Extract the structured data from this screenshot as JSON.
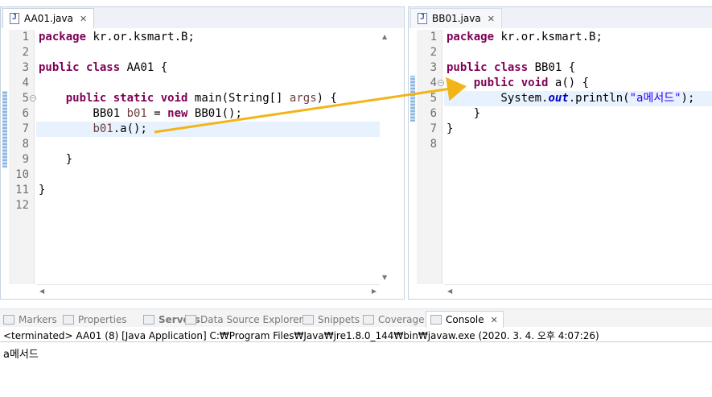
{
  "left_editor": {
    "tab_label": "AA01.java",
    "line_numbers": [
      "1",
      "2",
      "3",
      "4",
      "5",
      "6",
      "7",
      "8",
      "9",
      "10",
      "11",
      "12"
    ],
    "lines": [
      [
        {
          "t": "package ",
          "c": "kw"
        },
        {
          "t": "kr.or.ksmart.B;"
        }
      ],
      [],
      [
        {
          "t": "public ",
          "c": "kw"
        },
        {
          "t": "class ",
          "c": "kw"
        },
        {
          "t": "AA01 {"
        }
      ],
      [],
      [
        {
          "t": "    "
        },
        {
          "t": "public ",
          "c": "kw"
        },
        {
          "t": "static ",
          "c": "kw"
        },
        {
          "t": "void ",
          "c": "kw"
        },
        {
          "t": "main(String[] "
        },
        {
          "t": "args",
          "c": "param"
        },
        {
          "t": ") {"
        }
      ],
      [
        {
          "t": "        BB01 "
        },
        {
          "t": "b01",
          "c": "var"
        },
        {
          "t": " = "
        },
        {
          "t": "new ",
          "c": "kw"
        },
        {
          "t": "BB01();"
        }
      ],
      [
        {
          "t": "        "
        },
        {
          "t": "b01",
          "c": "var"
        },
        {
          "t": ".a();"
        }
      ],
      [],
      [
        {
          "t": "    }"
        }
      ],
      [],
      [
        {
          "t": "}"
        }
      ],
      []
    ],
    "current_line": 7,
    "fold_line": 5
  },
  "right_editor": {
    "tab_label": "BB01.java",
    "line_numbers": [
      "1",
      "2",
      "3",
      "4",
      "5",
      "6",
      "7",
      "8"
    ],
    "lines": [
      [
        {
          "t": "package ",
          "c": "kw"
        },
        {
          "t": "kr.or.ksmart.B;"
        }
      ],
      [],
      [
        {
          "t": "public ",
          "c": "kw"
        },
        {
          "t": "class ",
          "c": "kw"
        },
        {
          "t": "BB01 {"
        }
      ],
      [
        {
          "t": "    "
        },
        {
          "t": "public ",
          "c": "kw"
        },
        {
          "t": "void ",
          "c": "kw"
        },
        {
          "t": "a() {"
        }
      ],
      [
        {
          "t": "        System."
        },
        {
          "t": "out",
          "c": "fld"
        },
        {
          "t": ".println("
        },
        {
          "t": "\"a메서드\"",
          "c": "str"
        },
        {
          "t": ");"
        }
      ],
      [
        {
          "t": "    }"
        }
      ],
      [
        {
          "t": "}"
        }
      ],
      []
    ],
    "current_line": 5,
    "fold_line": 4
  },
  "bottom_tabs": [
    {
      "label": "Markers",
      "icon": "markers-icon"
    },
    {
      "label": "Properties",
      "icon": "properties-icon"
    },
    {
      "label": "Servers",
      "icon": "servers-icon"
    },
    {
      "label": "Data Source Explorer",
      "icon": "data-source-icon"
    },
    {
      "label": "Snippets",
      "icon": "snippets-icon"
    },
    {
      "label": "Coverage",
      "icon": "coverage-icon"
    },
    {
      "label": "Console",
      "icon": "console-icon"
    }
  ],
  "console": {
    "status": "<terminated> AA01 (8) [Java Application] C:₩Program Files₩Java₩jre1.8.0_144₩bin₩javaw.exe (2020. 3. 4. 오후 4:07:26)",
    "output": "a메서드"
  },
  "colors": {
    "keyword": "#7f0055",
    "string": "#2a00ff",
    "arrow": "#f2b517"
  }
}
